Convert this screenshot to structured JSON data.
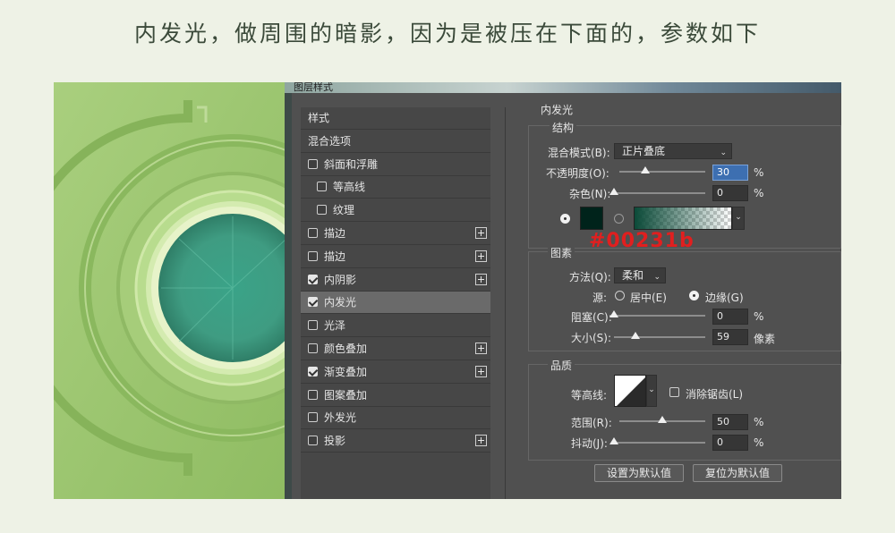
{
  "caption": "内发光，做周围的暗影，因为是被压在下面的，参数如下",
  "window_title": "图层样式",
  "layer_styles": [
    {
      "label": "样式",
      "checkbox": false,
      "checked": false,
      "plus": false,
      "indent": 0,
      "active": false
    },
    {
      "label": "混合选项",
      "checkbox": false,
      "checked": false,
      "plus": false,
      "indent": 0,
      "active": false
    },
    {
      "label": "斜面和浮雕",
      "checkbox": true,
      "checked": false,
      "plus": false,
      "indent": 0,
      "active": false
    },
    {
      "label": "等高线",
      "checkbox": true,
      "checked": false,
      "plus": false,
      "indent": 1,
      "active": false
    },
    {
      "label": "纹理",
      "checkbox": true,
      "checked": false,
      "plus": false,
      "indent": 1,
      "active": false
    },
    {
      "label": "描边",
      "checkbox": true,
      "checked": false,
      "plus": true,
      "indent": 0,
      "active": false
    },
    {
      "label": "描边",
      "checkbox": true,
      "checked": false,
      "plus": true,
      "indent": 0,
      "active": false
    },
    {
      "label": "内阴影",
      "checkbox": true,
      "checked": true,
      "plus": true,
      "indent": 0,
      "active": false
    },
    {
      "label": "内发光",
      "checkbox": true,
      "checked": true,
      "plus": false,
      "indent": 0,
      "active": true
    },
    {
      "label": "光泽",
      "checkbox": true,
      "checked": false,
      "plus": false,
      "indent": 0,
      "active": false
    },
    {
      "label": "颜色叠加",
      "checkbox": true,
      "checked": false,
      "plus": true,
      "indent": 0,
      "active": false
    },
    {
      "label": "渐变叠加",
      "checkbox": true,
      "checked": true,
      "plus": true,
      "indent": 0,
      "active": false
    },
    {
      "label": "图案叠加",
      "checkbox": true,
      "checked": false,
      "plus": false,
      "indent": 0,
      "active": false
    },
    {
      "label": "外发光",
      "checkbox": true,
      "checked": false,
      "plus": false,
      "indent": 0,
      "active": false
    },
    {
      "label": "投影",
      "checkbox": true,
      "checked": false,
      "plus": true,
      "indent": 0,
      "active": false
    }
  ],
  "panel": {
    "title": "内发光",
    "structure": {
      "title": "结构",
      "blend_mode_label": "混合模式(B):",
      "blend_mode_value": "正片叠底",
      "opacity_label": "不透明度(O):",
      "opacity_value": "30",
      "opacity_fraction": 0.3,
      "noise_label": "杂色(N):",
      "noise_value": "0",
      "noise_fraction": 0,
      "percent": "%",
      "glow_color": "#00231b"
    },
    "elements": {
      "title": "图素",
      "technique_label": "方法(Q):",
      "technique_value": "柔和",
      "source_label": "源:",
      "source_center": "居中(E)",
      "source_edge": "边缘(G)",
      "choke_label": "阻塞(C):",
      "choke_value": "0",
      "choke_fraction": 0,
      "size_label": "大小(S):",
      "size_value": "59",
      "size_fraction": 0.24,
      "size_unit": "像素"
    },
    "quality": {
      "title": "品质",
      "contour_label": "等高线:",
      "antialias_label": "消除锯齿(L)",
      "range_label": "范围(R):",
      "range_value": "50",
      "range_fraction": 0.5,
      "jitter_label": "抖动(J):",
      "jitter_value": "0",
      "jitter_fraction": 0
    },
    "make_default": "设置为默认值",
    "reset_default": "复位为默认值"
  },
  "hex_annotation": "#00231b"
}
